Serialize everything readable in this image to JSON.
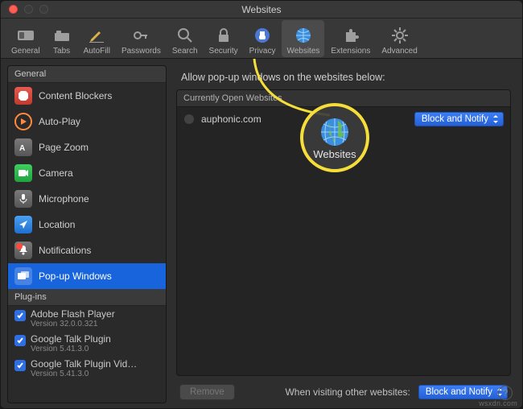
{
  "window": {
    "title": "Websites"
  },
  "toolbar": {
    "items": [
      {
        "label": "General"
      },
      {
        "label": "Tabs"
      },
      {
        "label": "AutoFill"
      },
      {
        "label": "Passwords"
      },
      {
        "label": "Search"
      },
      {
        "label": "Security"
      },
      {
        "label": "Privacy"
      },
      {
        "label": "Websites"
      },
      {
        "label": "Extensions"
      },
      {
        "label": "Advanced"
      }
    ]
  },
  "sidebar": {
    "section_general": "General",
    "items": [
      {
        "label": "Content Blockers"
      },
      {
        "label": "Auto-Play"
      },
      {
        "label": "Page Zoom"
      },
      {
        "label": "Camera"
      },
      {
        "label": "Microphone"
      },
      {
        "label": "Location"
      },
      {
        "label": "Notifications"
      },
      {
        "label": "Pop-up Windows"
      }
    ],
    "section_plugins": "Plug-ins",
    "plugins": [
      {
        "name": "Adobe Flash Player",
        "version": "Version 32.0.0.321"
      },
      {
        "name": "Google Talk Plugin",
        "version": "Version 5.41.3.0"
      },
      {
        "name": "Google Talk Plugin Vid…",
        "version": "Version 5.41.3.0"
      }
    ]
  },
  "main": {
    "heading": "Allow pop-up windows on the websites below:",
    "panel_header": "Currently Open Websites",
    "rows": [
      {
        "site": "auphonic.com",
        "policy": "Block and Notify"
      }
    ],
    "remove_label": "Remove",
    "footer_label": "When visiting other websites:",
    "footer_policy": "Block and Notify"
  },
  "callout": {
    "label": "Websites"
  },
  "help": "?",
  "watermark": "wsxdn.com"
}
